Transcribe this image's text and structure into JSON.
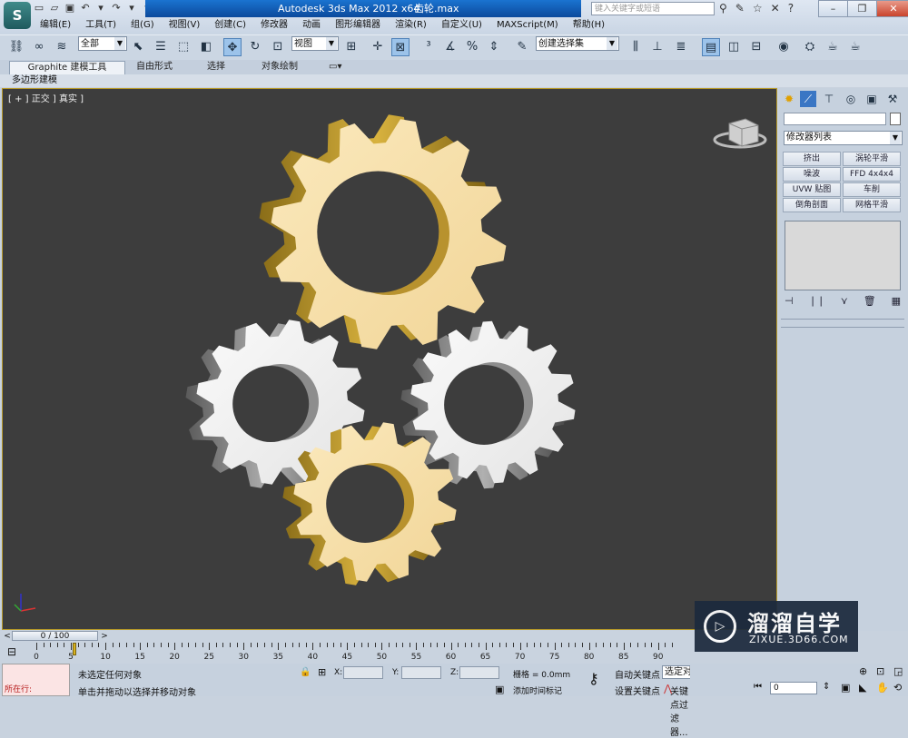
{
  "window": {
    "app_title": "Autodesk 3ds Max  2012 x64",
    "file_name": "齿轮.max",
    "search_placeholder": "键入关键字或短语",
    "logo_glyph": "S"
  },
  "menu": [
    "编辑(E)",
    "工具(T)",
    "组(G)",
    "视图(V)",
    "创建(C)",
    "修改器",
    "动画",
    "图形编辑器",
    "渲染(R)",
    "自定义(U)",
    "MAXScript(M)",
    "帮助(H)"
  ],
  "toolbar": {
    "selection_filter": "全部",
    "ref_coord": "视图",
    "named_selection": "创建选择集"
  },
  "ribbon": {
    "tabs": [
      "Graphite 建模工具",
      "自由形式",
      "选择",
      "对象绘制"
    ],
    "sub_label": "多边形建模"
  },
  "viewport": {
    "label": "[ + ] 正交 ] 真实 ]",
    "gear_colors": {
      "gold": "#f4dca4",
      "gold_side": "#c8a23a",
      "silver": "#eeeeee",
      "silver_side": "#7a7a7a"
    }
  },
  "command_panel": {
    "modifier_list": "修改器列表",
    "modifiers": [
      "挤出",
      "涡轮平滑",
      "噪波",
      "FFD 4x4x4",
      "UVW 贴图",
      "车削",
      "倒角剖面",
      "网格平滑"
    ]
  },
  "time_slider": {
    "position": "0 / 100"
  },
  "trackbar": {
    "ticks": [
      0,
      5,
      10,
      15,
      20,
      25,
      30,
      35,
      40,
      45,
      50,
      55,
      60,
      65,
      70,
      75,
      80,
      85,
      90
    ]
  },
  "status": {
    "maxscript_label": "所在行:",
    "selection_msg": "未选定任何对象",
    "prompt_msg": "单击并拖动以选择并移动对象",
    "x_label": "X:",
    "y_label": "Y:",
    "z_label": "Z:",
    "grid": "栅格 = 0.0mm",
    "add_time_tag": "添加时间标记",
    "auto_key": "自动关键点",
    "set_key": "设置关键点",
    "selected_obj": "选定对象",
    "key_filters": "关键点过滤器...",
    "frame": "0"
  },
  "watermark": {
    "brand_cn": "溜溜自学",
    "url": "ZIXUE.3D66.COM"
  }
}
